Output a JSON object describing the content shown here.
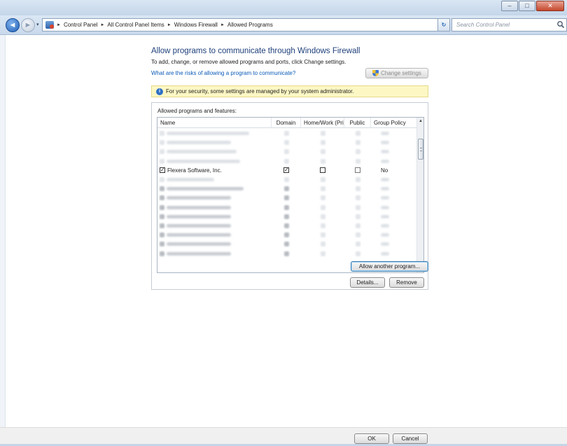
{
  "window": {
    "caption_minimize": "‒",
    "caption_maximize": "□",
    "caption_close": "✕"
  },
  "address": {
    "breadcrumbs": [
      "Control Panel",
      "All Control Panel Items",
      "Windows Firewall",
      "Allowed Programs"
    ],
    "search_placeholder": "Search Control Panel",
    "refresh_glyph": "↻",
    "back_glyph": "◄",
    "forward_glyph": "►",
    "dropdown_glyph": "▾"
  },
  "main": {
    "title": "Allow programs to communicate through Windows Firewall",
    "subtitle": "To add, change, or remove allowed programs and ports, click Change settings.",
    "risk_link": "What are the risks of allowing a program to communicate?",
    "change_settings_label": "Change settings",
    "info_text": "For your security, some settings are managed by your system administrator."
  },
  "programs": {
    "group_label": "Allowed programs and features:",
    "columns": {
      "name": "Name",
      "domain": "Domain",
      "home_work": "Home/Work (Pri...",
      "public": "Public",
      "group_policy": "Group Policy"
    },
    "visible_row": {
      "name": "Flexera Software, Inc.",
      "enabled": true,
      "domain": true,
      "home_work": false,
      "public": false,
      "group_policy": "No"
    },
    "details_label": "Details...",
    "remove_label": "Remove",
    "allow_another_label": "Allow another program..."
  },
  "footer": {
    "ok_label": "OK",
    "cancel_label": "Cancel"
  },
  "colors": {
    "title_blue": "#1e3f7a",
    "link_blue": "#0b5ab8",
    "info_bg": "#fdf7c4"
  }
}
